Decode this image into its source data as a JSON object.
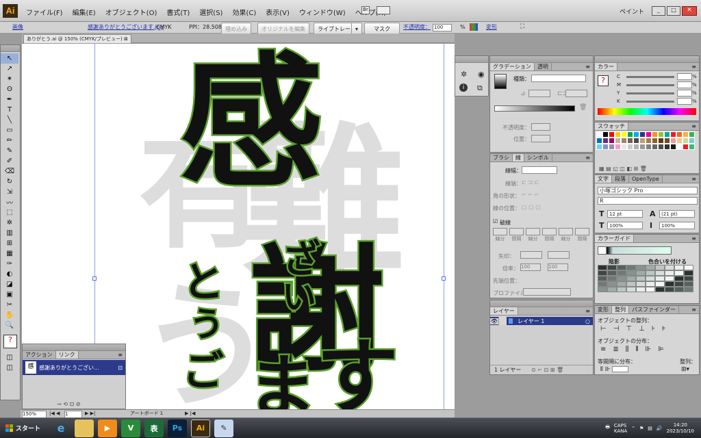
{
  "app": {
    "logo": "Ai",
    "workspace": "ペイント"
  },
  "menu": [
    "ファイル(F)",
    "編集(E)",
    "オブジェクト(O)",
    "書式(T)",
    "選択(S)",
    "効果(C)",
    "表示(V)",
    "ウィンドウ(W)",
    "ヘルプ(H)"
  ],
  "control": {
    "kind": "画像",
    "file": "感謝ありがとうございます.jpg",
    "mode": "CMYK",
    "ppi": "PPI：28.508",
    "embed": "埋め込み",
    "edit_original": "オリジナルを編集",
    "live_trace": "ライブトレース",
    "mask": "マスク",
    "opacity_label": "不透明度：",
    "opacity": "100",
    "pct": "%",
    "transform": "変形"
  },
  "doc_tab": "ありがとう.ai @ 150% (CMYK/プレビュー)",
  "artwork": {
    "chars": [
      "感",
      "謝",
      "と",
      "う",
      "ご",
      "ざ",
      "い",
      "ま",
      "す"
    ],
    "ghost": [
      "有",
      "難",
      "う"
    ]
  },
  "gradient": {
    "tabs": [
      "グラデーション",
      "透明"
    ],
    "type_label": "種類：",
    "opacity_label": "不透明度：",
    "position_label": "位置："
  },
  "stroke": {
    "tabs": [
      "ブラシ",
      "線",
      "シンボル"
    ],
    "width_label": "線幅：",
    "cap_label": "線端：",
    "corner_label": "角の形状：",
    "align_label": "線の位置：",
    "dashed_label": "破線",
    "dash_cells": [
      "線分",
      "間隔",
      "線分",
      "間隔",
      "線分",
      "間隔"
    ],
    "arrow_label": "矢印：",
    "scale_label": "倍率：",
    "scale_val": "100",
    "pos_label": "先端位置：",
    "profile_label": "プロファイル："
  },
  "layers": {
    "tab": "レイヤー",
    "name": "レイヤー 1",
    "count": "1 レイヤー"
  },
  "color": {
    "tab": "カラー",
    "channels": [
      "C",
      "M",
      "Y",
      "K"
    ]
  },
  "swatches": {
    "tab": "スウォッチ",
    "colors": [
      "#ffffff",
      "#000000",
      "#ff0000",
      "#ffcc00",
      "#ffff00",
      "#00a651",
      "#00aeef",
      "#2e3192",
      "#ec008c",
      "#f7941d",
      "#8dc63f",
      "#00a99d",
      "#ed1c24",
      "#f26522",
      "#fbaf3f",
      "#39b54a",
      "#0072bc",
      "#662d91",
      "#9e005d",
      "#c7b299",
      "#998675",
      "#736357",
      "#534741",
      "#c69c6d",
      "#a67c52",
      "#8c6239",
      "#603913",
      "#754c24",
      "#f5989d",
      "#fdc689",
      "#c4df9b",
      "#7accc8",
      "#6dcff6",
      "#8393ca",
      "#a186be",
      "#f49ac1",
      "#e6e6e6",
      "#cccccc",
      "#b3b3b3",
      "#999999",
      "#808080",
      "#666666",
      "#4d4d4d",
      "#333333",
      "#1a1a1a",
      "#ffffff",
      "#ed1c24",
      "#3cb878"
    ]
  },
  "type": {
    "tabs": [
      "文字",
      "段落",
      "OpenType"
    ],
    "font": "小塚ゴシック Pro",
    "style": "R",
    "size": "12 pt",
    "leading": "(21 pt)",
    "hscale": "100%",
    "vscale": "100%"
  },
  "guide": {
    "tab": "カラーガイド",
    "shade_label": "陰影",
    "tint_label": "色合いを付ける"
  },
  "align": {
    "tabs": [
      "変形",
      "整列",
      "パスファインダー"
    ],
    "align_obj": "オブジェクトの整列：",
    "distribute": "オブジェクトの分布：",
    "spacing": "等間隔に分布：",
    "align_to": "整列："
  },
  "actions": {
    "tabs": [
      "アクション",
      "リンク"
    ],
    "item": "感謝ありがとうござい..."
  },
  "status": {
    "zoom": "150%",
    "page": "1",
    "artboard": "アートボード 1"
  },
  "taskbar": {
    "start": "スタート",
    "time": "14:20",
    "date": "2023/10/10",
    "caps": "CAPS",
    "kana": "KANA"
  }
}
